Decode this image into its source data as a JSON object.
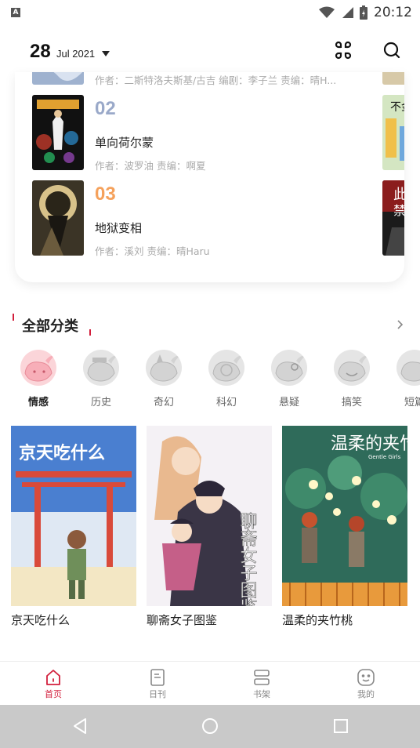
{
  "status_bar": {
    "app_badge": "A",
    "time": "20:12"
  },
  "header": {
    "day": "28",
    "month_year": "Jul  2021",
    "grid_icon": "apps-grid-icon",
    "search_icon": "search-icon"
  },
  "ranking": {
    "partial_meta": "作者：二斯特洛夫斯基/古吉  编剧：李子兰  责编：晴H...",
    "items": [
      {
        "rank": "02",
        "title": "单向荷尔蒙",
        "meta": "作者：波罗油  责编：啊夏",
        "color": "#9aa9c9"
      },
      {
        "rank": "03",
        "title": "地狱变相",
        "meta": "作者：溪刘  责编：晴Haru",
        "color": "#f5a15b"
      }
    ],
    "side_texts": [
      "不金",
      "此",
      "禁"
    ]
  },
  "categories": {
    "title": "全部分类",
    "items": [
      {
        "label": "情感",
        "active": true
      },
      {
        "label": "历史",
        "active": false
      },
      {
        "label": "奇幻",
        "active": false
      },
      {
        "label": "科幻",
        "active": false
      },
      {
        "label": "悬疑",
        "active": false
      },
      {
        "label": "搞笑",
        "active": false
      },
      {
        "label": "短篇",
        "active": false
      }
    ]
  },
  "comics": [
    {
      "title": "京天吃什么",
      "cover_text": "京天吃什么"
    },
    {
      "title": "聊斋女子图鉴",
      "cover_text": "聊斋女子图鉴"
    },
    {
      "title": "温柔的夹竹桃",
      "cover_text": "温柔的夹竹桃",
      "cover_subtext": "Gentle Girls"
    }
  ],
  "bottom_nav": [
    {
      "label": "首页",
      "icon": "home-icon",
      "active": true
    },
    {
      "label": "日刊",
      "icon": "daily-icon",
      "active": false
    },
    {
      "label": "书架",
      "icon": "bookshelf-icon",
      "active": false
    },
    {
      "label": "我的",
      "icon": "profile-icon",
      "active": false
    }
  ],
  "colors": {
    "accent": "#d21f3c",
    "rank2": "#9aa9c9",
    "rank3": "#f5a15b"
  }
}
